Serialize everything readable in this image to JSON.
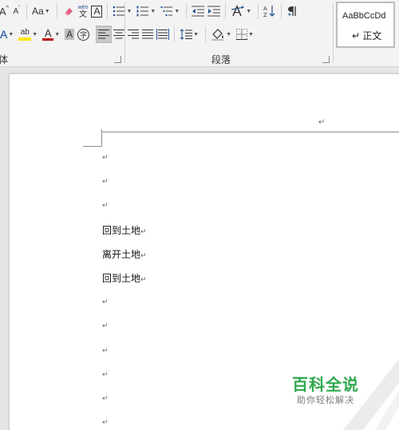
{
  "ribbon": {
    "font_group": {
      "label": "体",
      "grow_font_icon": "A",
      "shrink_font_icon": "A",
      "change_case_label": "Aa",
      "phonetic_guide_top": "wén",
      "phonetic_guide_bottom": "文",
      "char_border_label": "A",
      "text_effect_label": "A",
      "highlight_label": "ab",
      "font_color_label": "A",
      "char_shading_label": "A",
      "enclose_char_label": "字"
    },
    "paragraph_group": {
      "label": "段落"
    },
    "styles": {
      "sample_text": "AaBbCcDd",
      "style_name": "↵ 正文"
    },
    "colors": {
      "highlight": "#ffe600",
      "font_color": "#c00000",
      "accent_blue": "#2b5797"
    }
  },
  "document": {
    "header_mark": "↵",
    "lines": [
      {
        "text": "",
        "mark": "↵"
      },
      {
        "text": "",
        "mark": "↵"
      },
      {
        "text": "",
        "mark": "↵"
      },
      {
        "text": "回到土地",
        "mark": "↵"
      },
      {
        "text": "离开土地",
        "mark": "↵"
      },
      {
        "text": "回到土地",
        "mark": "↵"
      },
      {
        "text": "",
        "mark": "↵"
      },
      {
        "text": "",
        "mark": "↵"
      },
      {
        "text": "",
        "mark": "↵"
      },
      {
        "text": "",
        "mark": "↵"
      },
      {
        "text": "",
        "mark": "↵"
      },
      {
        "text": "",
        "mark": "↵"
      }
    ]
  },
  "watermark": {
    "title": "百科全说",
    "subtitle": "助你轻松解决"
  }
}
